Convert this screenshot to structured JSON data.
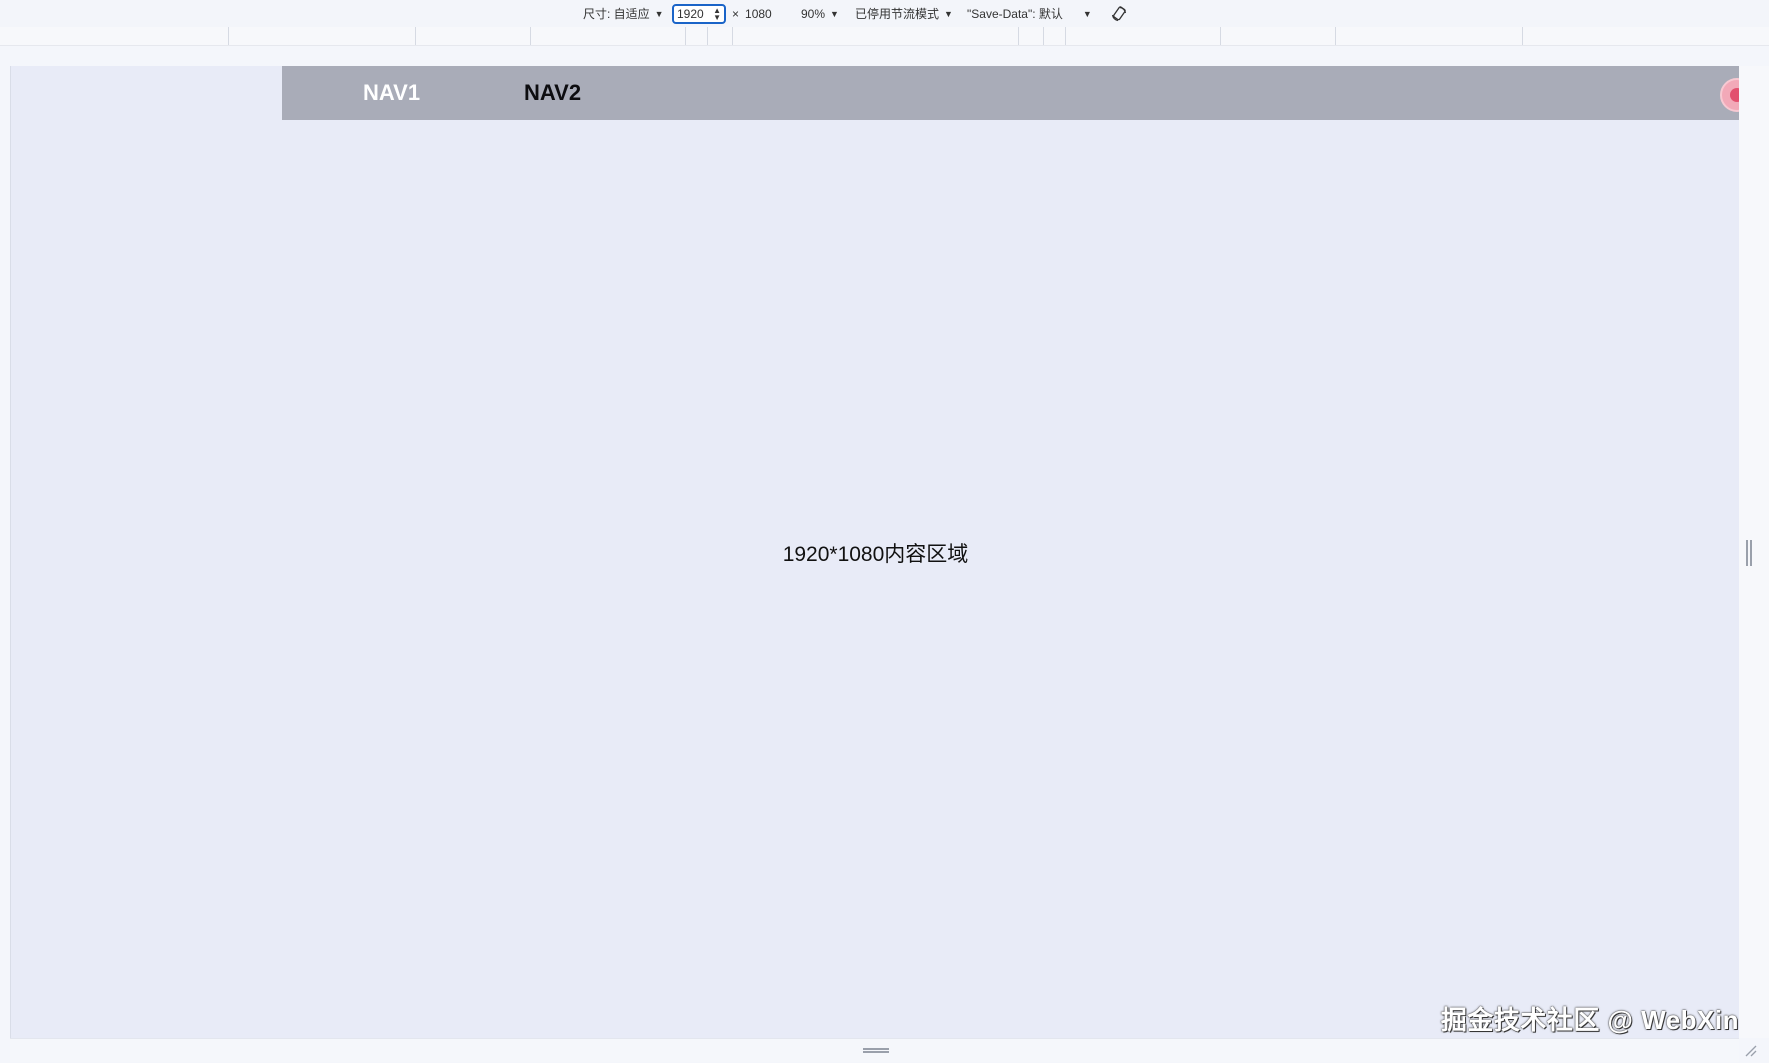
{
  "toolbar": {
    "size_label": "尺寸: 自适应",
    "width_value": "1920",
    "times": "×",
    "height_value": "1080",
    "zoom": "90%",
    "throttle": "已停用节流模式",
    "save_data": "\"Save-Data\": 默认"
  },
  "page": {
    "nav1": "NAV1",
    "nav2": "NAV2",
    "content_text": "1920*1080内容区域"
  },
  "watermark": "掘金技术社区 @ WebXin",
  "colors": {
    "nav_bar": "#a9acb8",
    "viewport_bg": "#e8ebf7",
    "nav1_text": "#ffffff",
    "nav2_text": "#0d0d10",
    "input_focus": "#1a64c8"
  }
}
